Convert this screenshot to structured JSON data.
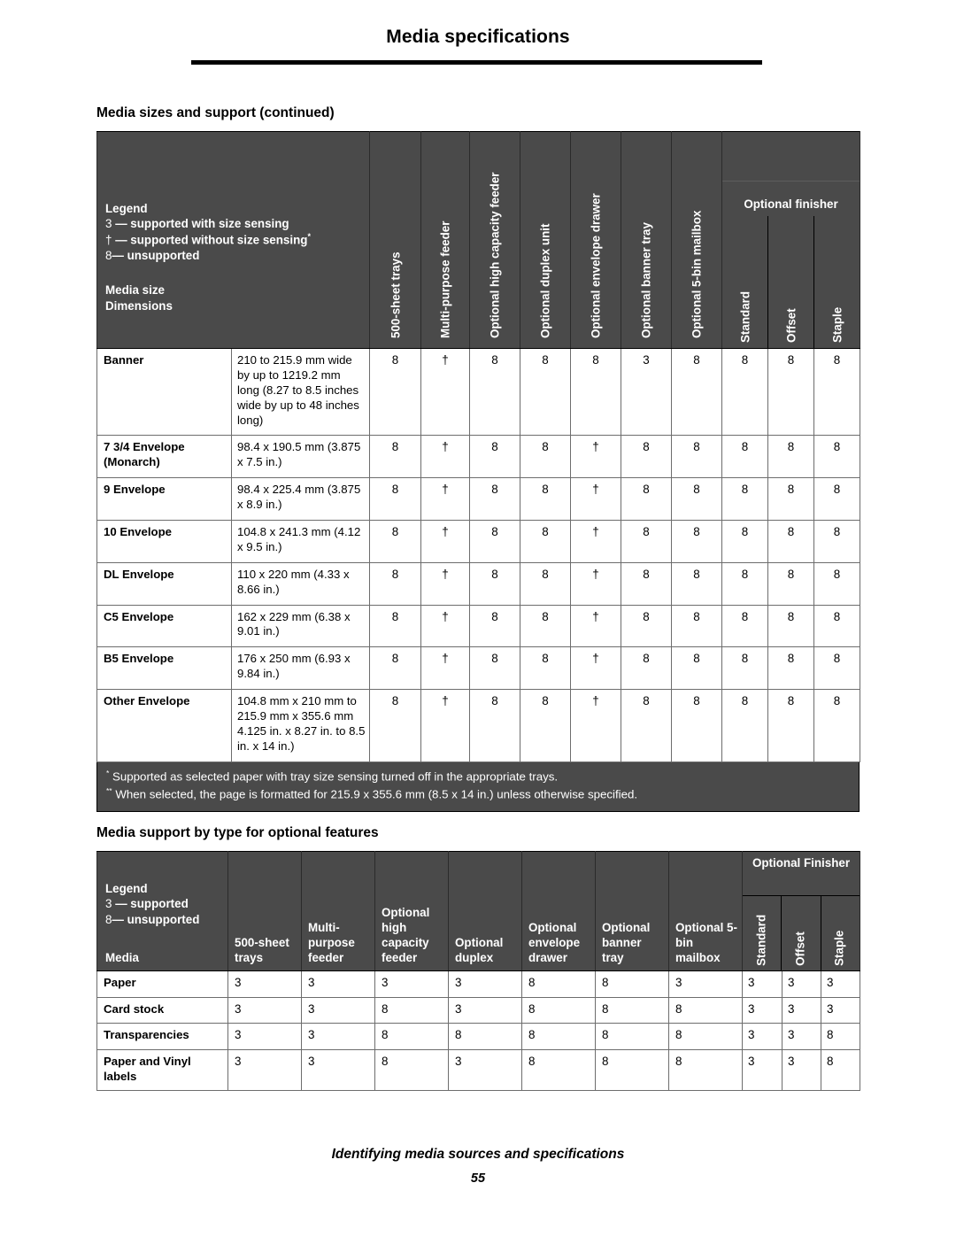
{
  "document": {
    "header_title": "Media specifications",
    "footer_text": "Identifying media sources and specifications",
    "page_number": "55",
    "accent_gray": "#4a4a4a"
  },
  "section1": {
    "heading": "Media sizes and support (continued)",
    "legend": {
      "title": "Legend",
      "line1_symbol": "3",
      "line1_text": "— supported with size sensing",
      "line2_symbol": "†",
      "line2_text": "— supported without size sensing",
      "line2_sup": "*",
      "line3_symbol": "8",
      "line3_text": "— unsupported",
      "media_size_label": "Media size",
      "dimensions_label": "Dimensions"
    },
    "columns": [
      "500-sheet trays",
      "Multi-purpose feeder",
      "Optional high capacity feeder",
      "Optional duplex unit",
      "Optional envelope drawer",
      "Optional banner tray",
      "Optional 5-bin mailbox"
    ],
    "finisher_group": "Optional finisher",
    "finisher_columns": [
      "Standard",
      "Offset",
      "Staple"
    ],
    "rows": [
      {
        "media": "Banner",
        "dimensions": "210 to 215.9 mm wide by up to 1219.2 mm long (8.27 to 8.5 inches wide by up to 48 inches long)",
        "marks": [
          "8",
          "†",
          "8",
          "8",
          "8",
          "3",
          "8",
          "8",
          "8",
          "8"
        ]
      },
      {
        "media": "7 3/4 Envelope (Monarch)",
        "dimensions": "98.4 x 190.5 mm (3.875 x 7.5 in.)",
        "marks": [
          "8",
          "†",
          "8",
          "8",
          "†",
          "8",
          "8",
          "8",
          "8",
          "8"
        ]
      },
      {
        "media": "9 Envelope",
        "dimensions": "98.4 x 225.4 mm (3.875 x 8.9 in.)",
        "marks": [
          "8",
          "†",
          "8",
          "8",
          "†",
          "8",
          "8",
          "8",
          "8",
          "8"
        ]
      },
      {
        "media": "10 Envelope",
        "dimensions": "104.8 x 241.3 mm (4.12 x 9.5 in.)",
        "marks": [
          "8",
          "†",
          "8",
          "8",
          "†",
          "8",
          "8",
          "8",
          "8",
          "8"
        ]
      },
      {
        "media": "DL Envelope",
        "dimensions": "110 x 220 mm (4.33 x 8.66 in.)",
        "marks": [
          "8",
          "†",
          "8",
          "8",
          "†",
          "8",
          "8",
          "8",
          "8",
          "8"
        ]
      },
      {
        "media": "C5 Envelope",
        "dimensions": "162 x 229 mm (6.38 x 9.01 in.)",
        "marks": [
          "8",
          "†",
          "8",
          "8",
          "†",
          "8",
          "8",
          "8",
          "8",
          "8"
        ]
      },
      {
        "media": "B5 Envelope",
        "dimensions": "176 x 250 mm (6.93 x 9.84 in.)",
        "marks": [
          "8",
          "†",
          "8",
          "8",
          "†",
          "8",
          "8",
          "8",
          "8",
          "8"
        ]
      },
      {
        "media": "Other Envelope",
        "dimensions": "104.8 mm x 210 mm to 215.9 mm x 355.6 mm 4.125 in. x 8.27 in. to 8.5 in. x 14 in.)",
        "marks": [
          "8",
          "†",
          "8",
          "8",
          "†",
          "8",
          "8",
          "8",
          "8",
          "8"
        ]
      }
    ],
    "footnotes": [
      {
        "marker": "*",
        "text": "Supported as selected paper with tray size sensing turned off in the appropriate trays."
      },
      {
        "marker": "**",
        "text": "When selected, the page is formatted for 215.9 x 355.6 mm (8.5 x 14 in.) unless otherwise specified."
      }
    ]
  },
  "section2": {
    "heading": "Media support by type for optional features",
    "legend": {
      "title": "Legend",
      "line1_symbol": "3",
      "line1_text": "— supported",
      "line2_symbol": "8",
      "line2_text": "— unsupported",
      "media_label": "Media"
    },
    "columns": [
      "500-sheet trays",
      "Multi-purpose feeder",
      "Optional high capacity feeder",
      "Optional duplex",
      "Optional envelope drawer",
      "Optional banner tray",
      "Optional 5-bin mailbox"
    ],
    "finisher_group": "Optional Finisher",
    "finisher_columns": [
      "Standard",
      "Offset",
      "Staple"
    ],
    "rows": [
      {
        "media": "Paper",
        "marks": [
          "3",
          "3",
          "3",
          "3",
          "8",
          "8",
          "3",
          "3",
          "3",
          "3"
        ]
      },
      {
        "media": "Card stock",
        "marks": [
          "3",
          "3",
          "8",
          "3",
          "8",
          "8",
          "8",
          "3",
          "3",
          "3"
        ]
      },
      {
        "media": "Transparencies",
        "marks": [
          "3",
          "3",
          "8",
          "8",
          "8",
          "8",
          "8",
          "3",
          "3",
          "8"
        ]
      },
      {
        "media": "Paper and Vinyl labels",
        "marks": [
          "3",
          "3",
          "8",
          "3",
          "8",
          "8",
          "8",
          "3",
          "3",
          "8"
        ]
      }
    ]
  }
}
